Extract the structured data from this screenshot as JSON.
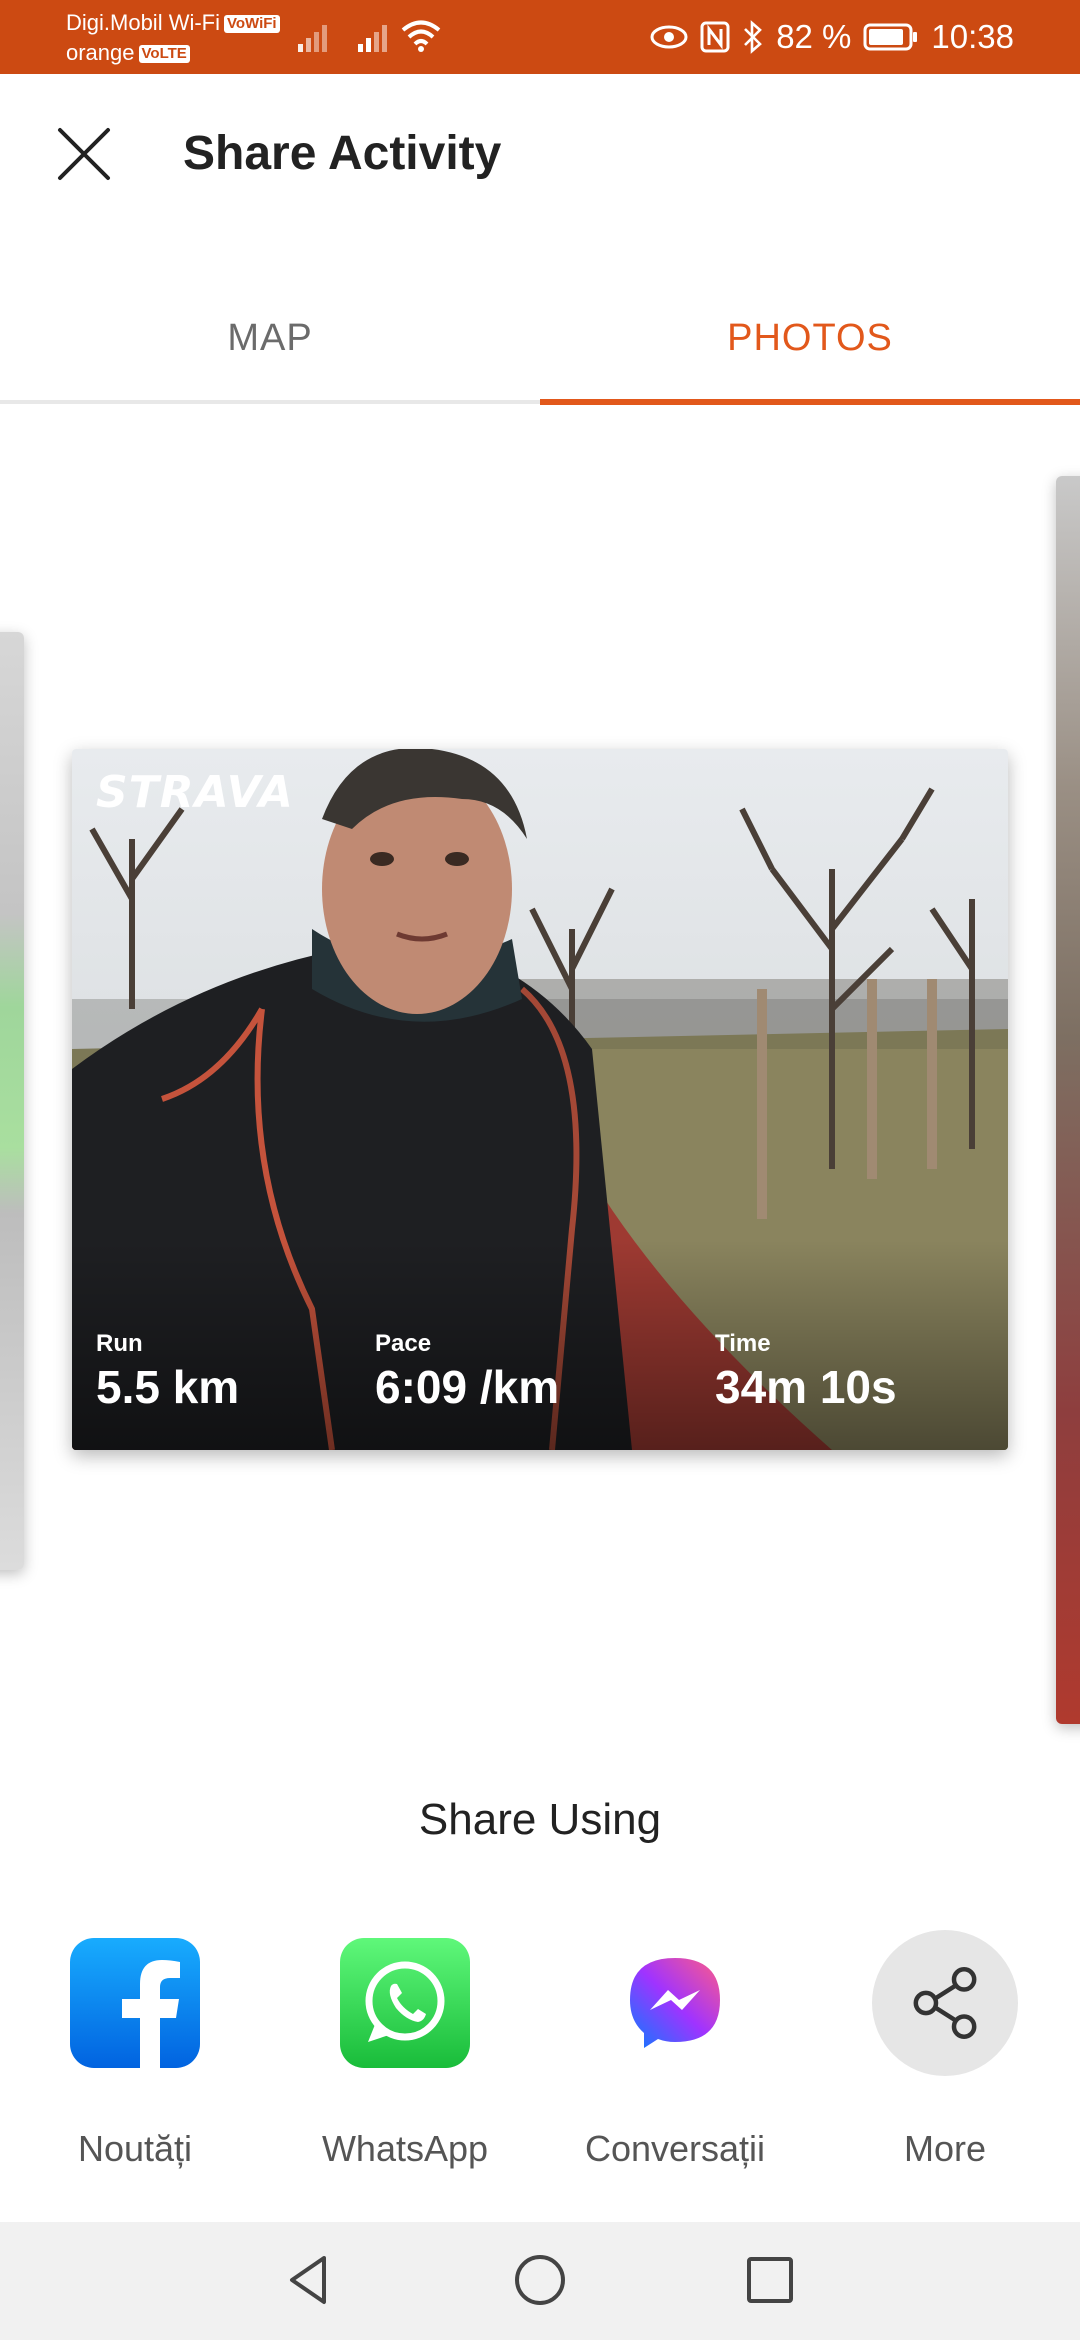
{
  "status_bar": {
    "carrier_1": "Digi.Mobil Wi-Fi",
    "carrier_1_badge": "VoWiFi",
    "carrier_2": "orange",
    "carrier_2_badge": "VoLTE",
    "battery": "82 %",
    "time": "10:38",
    "background": "#cc4a12"
  },
  "header": {
    "title": "Share Activity",
    "close_icon": "close-icon"
  },
  "tabs": [
    {
      "label": "MAP",
      "selected": false
    },
    {
      "label": "PHOTOS",
      "selected": true
    }
  ],
  "accent_color": "#e2581b",
  "card": {
    "logo": "STRAVA",
    "stats": [
      {
        "label": "Run",
        "value": "5.5 km"
      },
      {
        "label": "Pace",
        "value": "6:09 /km"
      },
      {
        "label": "Time",
        "value": "34m 10s"
      }
    ]
  },
  "share": {
    "title": "Share Using",
    "options": [
      {
        "label": "Noutăți",
        "icon": "facebook-icon",
        "color": "#1877f2"
      },
      {
        "label": "WhatsApp",
        "icon": "whatsapp-icon",
        "color": "#25d366"
      },
      {
        "label": "Conversații",
        "icon": "messenger-icon",
        "color": "#8a3ffc"
      },
      {
        "label": "More",
        "icon": "share-icon",
        "color": "#e6e6e6"
      }
    ]
  },
  "nav": {
    "back_icon": "back-triangle-icon",
    "home_icon": "home-circle-icon",
    "recents_icon": "recents-square-icon"
  }
}
